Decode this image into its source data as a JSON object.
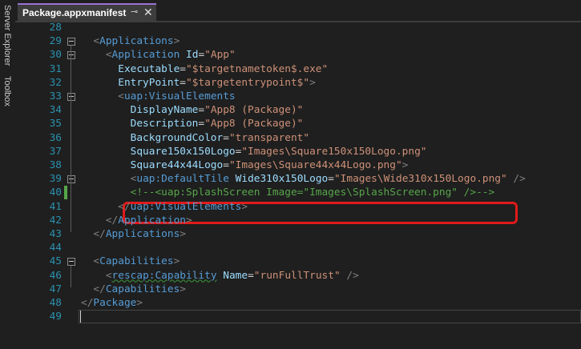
{
  "side_panels": {
    "server_explorer": "Server Explorer",
    "toolbox": "Toolbox"
  },
  "tab": {
    "title": "Package.appxmanifest",
    "pin_icon": "pin-icon",
    "close_icon": "close-icon"
  },
  "lines": [
    {
      "num": "28",
      "tokens": []
    },
    {
      "num": "29",
      "tokens": [
        [
          "p",
          "<"
        ],
        [
          "t",
          "Applications"
        ],
        [
          "p",
          ">"
        ]
      ],
      "indent": 1,
      "fold": true
    },
    {
      "num": "30",
      "tokens": [
        [
          "p",
          "<"
        ],
        [
          "t",
          "Application"
        ],
        [
          "v",
          " "
        ],
        [
          "a",
          "Id"
        ],
        [
          "v",
          "="
        ],
        [
          "s",
          "\"App\""
        ]
      ],
      "indent": 2,
      "fold": true
    },
    {
      "num": "31",
      "tokens": [
        [
          "a",
          "Executable"
        ],
        [
          "v",
          "="
        ],
        [
          "s",
          "\"$targetnametoken$.exe\""
        ]
      ],
      "indent": 3
    },
    {
      "num": "32",
      "tokens": [
        [
          "a",
          "EntryPoint"
        ],
        [
          "v",
          "="
        ],
        [
          "s",
          "\"$targetentrypoint$\""
        ],
        [
          "p",
          ">"
        ]
      ],
      "indent": 3
    },
    {
      "num": "33",
      "tokens": [
        [
          "p",
          "<"
        ],
        [
          "t",
          "uap:VisualElements"
        ]
      ],
      "indent": 3,
      "fold": true
    },
    {
      "num": "34",
      "tokens": [
        [
          "a",
          "DisplayName"
        ],
        [
          "v",
          "="
        ],
        [
          "s",
          "\"App8 (Package)\""
        ]
      ],
      "indent": 4
    },
    {
      "num": "35",
      "tokens": [
        [
          "a",
          "Description"
        ],
        [
          "v",
          "="
        ],
        [
          "s",
          "\"App8 (Package)\""
        ]
      ],
      "indent": 4
    },
    {
      "num": "36",
      "tokens": [
        [
          "a",
          "BackgroundColor"
        ],
        [
          "v",
          "="
        ],
        [
          "s",
          "\"transparent\""
        ]
      ],
      "indent": 4
    },
    {
      "num": "37",
      "tokens": [
        [
          "a",
          "Square150x150Logo"
        ],
        [
          "v",
          "="
        ],
        [
          "s",
          "\"Images\\Square150x150Logo.png\""
        ]
      ],
      "indent": 4
    },
    {
      "num": "38",
      "tokens": [
        [
          "a",
          "Square44x44Logo"
        ],
        [
          "v",
          "="
        ],
        [
          "s",
          "\"Images\\Square44x44Logo.png\""
        ],
        [
          "p",
          ">"
        ]
      ],
      "indent": 4
    },
    {
      "num": "39",
      "tokens": [
        [
          "p",
          "<"
        ],
        [
          "t",
          "uap:DefaultTile"
        ],
        [
          "v",
          " "
        ],
        [
          "a",
          "Wide310x150Logo"
        ],
        [
          "v",
          "="
        ],
        [
          "s",
          "\"Images\\Wide310x150Logo.png\""
        ],
        [
          "v",
          " "
        ],
        [
          "p",
          "/>"
        ]
      ],
      "indent": 4,
      "fold": true
    },
    {
      "num": "40",
      "tokens": [
        [
          "c",
          "<!--<uap:SplashScreen Image=\"Images\\SplashScreen.png\" />-->"
        ]
      ],
      "indent": 4,
      "changed": true,
      "highlighted": true
    },
    {
      "num": "41",
      "tokens": [
        [
          "p",
          "</"
        ],
        [
          "t",
          "uap:VisualElements"
        ],
        [
          "p",
          ">"
        ]
      ],
      "indent": 3
    },
    {
      "num": "42",
      "tokens": [
        [
          "p",
          "</"
        ],
        [
          "t",
          "Application"
        ],
        [
          "p",
          ">"
        ]
      ],
      "indent": 2
    },
    {
      "num": "43",
      "tokens": [
        [
          "p",
          "</"
        ],
        [
          "t",
          "Applications"
        ],
        [
          "p",
          ">"
        ]
      ],
      "indent": 1
    },
    {
      "num": "44",
      "tokens": []
    },
    {
      "num": "45",
      "tokens": [
        [
          "p",
          "<"
        ],
        [
          "t",
          "Capabilities"
        ],
        [
          "p",
          ">"
        ]
      ],
      "indent": 1,
      "fold": true
    },
    {
      "num": "46",
      "tokens": [
        [
          "p",
          "<"
        ],
        [
          "t",
          "rescap:Capability",
          "squiggle"
        ],
        [
          "v",
          " "
        ],
        [
          "a",
          "Name"
        ],
        [
          "v",
          "="
        ],
        [
          "s",
          "\"runFullTrust\""
        ],
        [
          "v",
          " "
        ],
        [
          "p",
          "/>"
        ]
      ],
      "indent": 2
    },
    {
      "num": "47",
      "tokens": [
        [
          "p",
          "</"
        ],
        [
          "t",
          "Capabilities"
        ],
        [
          "p",
          ">"
        ]
      ],
      "indent": 1
    },
    {
      "num": "48",
      "tokens": [
        [
          "p",
          "</"
        ],
        [
          "t",
          "Package"
        ],
        [
          "p",
          ">"
        ]
      ],
      "indent": 0
    },
    {
      "num": "49",
      "tokens": [],
      "current": true
    }
  ],
  "colors": {
    "tag": "#569cd6",
    "attribute": "#9cdcfe",
    "string": "#ce9178",
    "comment": "#57a64a",
    "line_number": "#2b91af",
    "highlight_box": "#e21a1a",
    "tab_accent": "#9a72d6"
  }
}
